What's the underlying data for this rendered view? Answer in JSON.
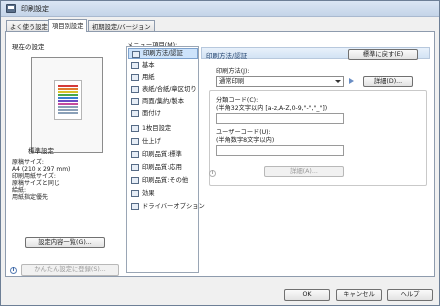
{
  "window": {
    "title": "印刷設定"
  },
  "tabs": [
    {
      "label": "よく使う設定"
    },
    {
      "label": "項目別設定"
    },
    {
      "label": "初期設定/バージョン"
    }
  ],
  "left": {
    "current_settings_label": "現在の設定",
    "summary_title": "標準設定",
    "summary_lines": [
      "原稿サイズ:",
      "  A4 (210 x 297 mm)",
      "印刷用紙サイズ:",
      "  原稿サイズと同じ",
      "給紙:",
      "  用紙指定優先"
    ],
    "list_button_label": "設定内容一覧(G)...",
    "register_button_label": "かんたん設定に登録(S)..."
  },
  "menu": {
    "label": "メニュー項目(M):",
    "items": [
      {
        "label": "印刷方法/認証",
        "icon": "print-method-icon"
      },
      {
        "label": "基本",
        "icon": "basic-icon"
      },
      {
        "label": "用紙",
        "icon": "paper-icon"
      },
      {
        "label": "表紙/合紙/章区切り",
        "icon": "cover-icon"
      },
      {
        "label": "両面/集約/製本",
        "icon": "duplex-icon"
      },
      {
        "label": "面付け",
        "icon": "imposition-icon"
      },
      {
        "label": "1枚目設定",
        "icon": "first-page-icon"
      },
      {
        "label": "仕上げ",
        "icon": "finishing-icon"
      },
      {
        "label": "印刷品質:標準",
        "icon": "quality-standard-icon"
      },
      {
        "label": "印刷品質:応用",
        "icon": "quality-advanced-icon"
      },
      {
        "label": "印刷品質:その他",
        "icon": "quality-other-icon"
      },
      {
        "label": "効果",
        "icon": "effects-icon"
      },
      {
        "label": "ドライバーオプション",
        "icon": "driver-options-icon"
      }
    ]
  },
  "pane": {
    "title": "印刷方法/認証",
    "reset_button_label": "標準に戻す(E)",
    "print_method_label": "印刷方法(J):",
    "print_method_value": "通常印刷",
    "details_button_label": "詳細(D)...",
    "class_code_label": "分類コード(C):",
    "class_code_hint": "(半角32文字以内 [a-z,A-Z,0-9,\"-\",\"_\"])",
    "class_code_value": "",
    "user_code_label": "ユーザーコード(U):",
    "user_code_hint": "(半角数字8文字以内)",
    "user_code_value": "",
    "disabled_button_label": "詳細(A)..."
  },
  "footer": {
    "ok_label": "OK",
    "cancel_label": "キャンセル",
    "help_label": "ヘルプ"
  },
  "colors": {
    "accent": "#2b5aa0",
    "selection": "#cde3fb"
  }
}
